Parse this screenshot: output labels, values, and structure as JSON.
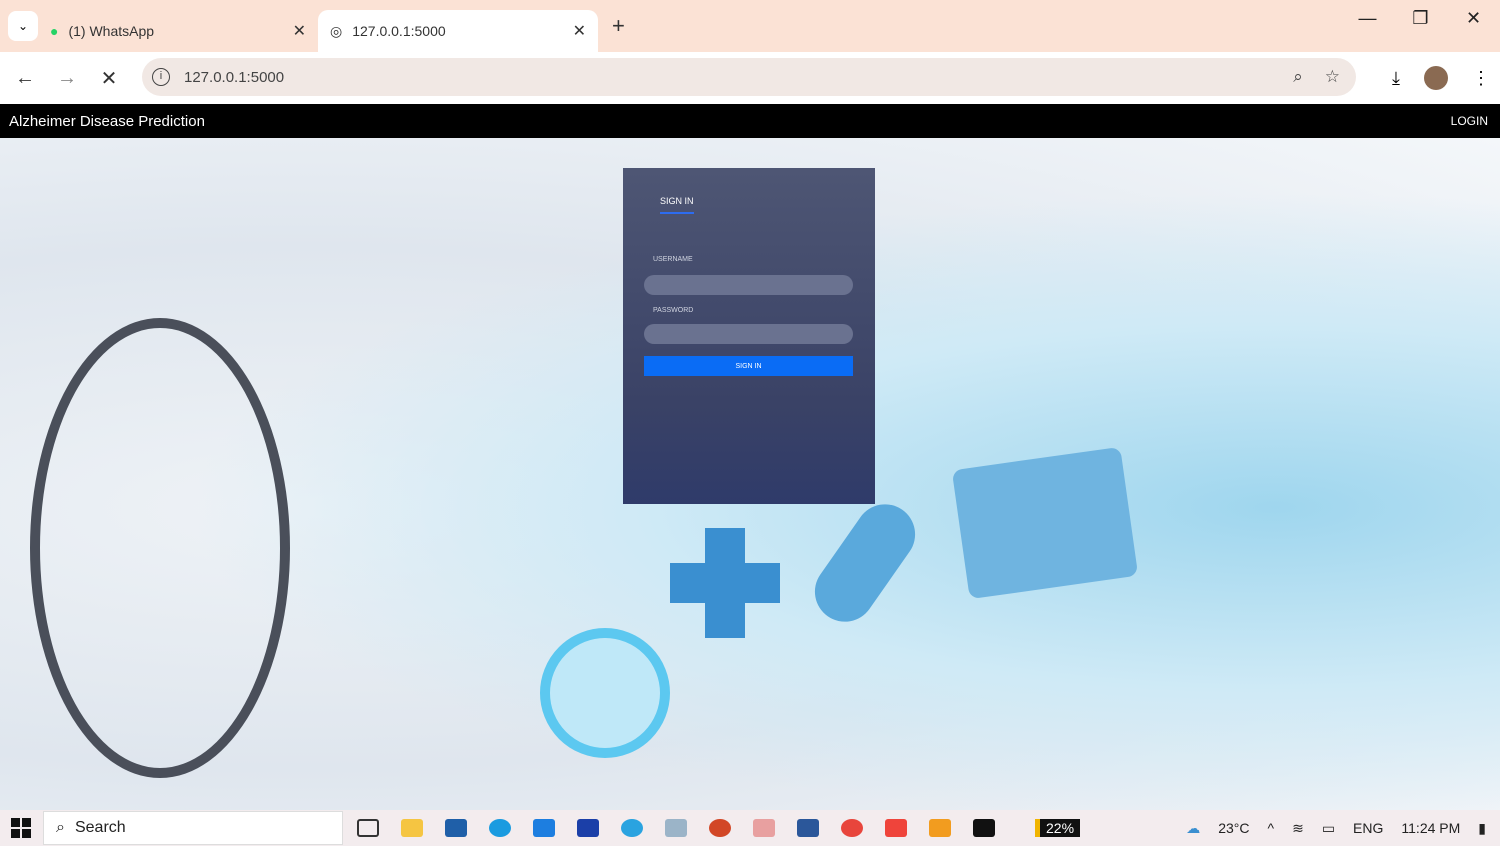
{
  "browser": {
    "tabs": [
      {
        "title": "(1) WhatsApp",
        "active": false
      },
      {
        "title": "127.0.0.1:5000",
        "active": true
      }
    ],
    "url": "127.0.0.1:5000"
  },
  "app": {
    "brand": "Alzheimer Disease Prediction",
    "login_link": "LOGIN"
  },
  "login_card": {
    "tab_title": "SIGN IN",
    "username_label": "USERNAME",
    "username_value": "",
    "password_label": "PASSWORD",
    "password_value": "",
    "submit_label": "SIGN IN"
  },
  "taskbar": {
    "search_label": "Search",
    "battery": "22%",
    "weather": "23°C",
    "language": "ENG",
    "time": "11:24 PM"
  }
}
